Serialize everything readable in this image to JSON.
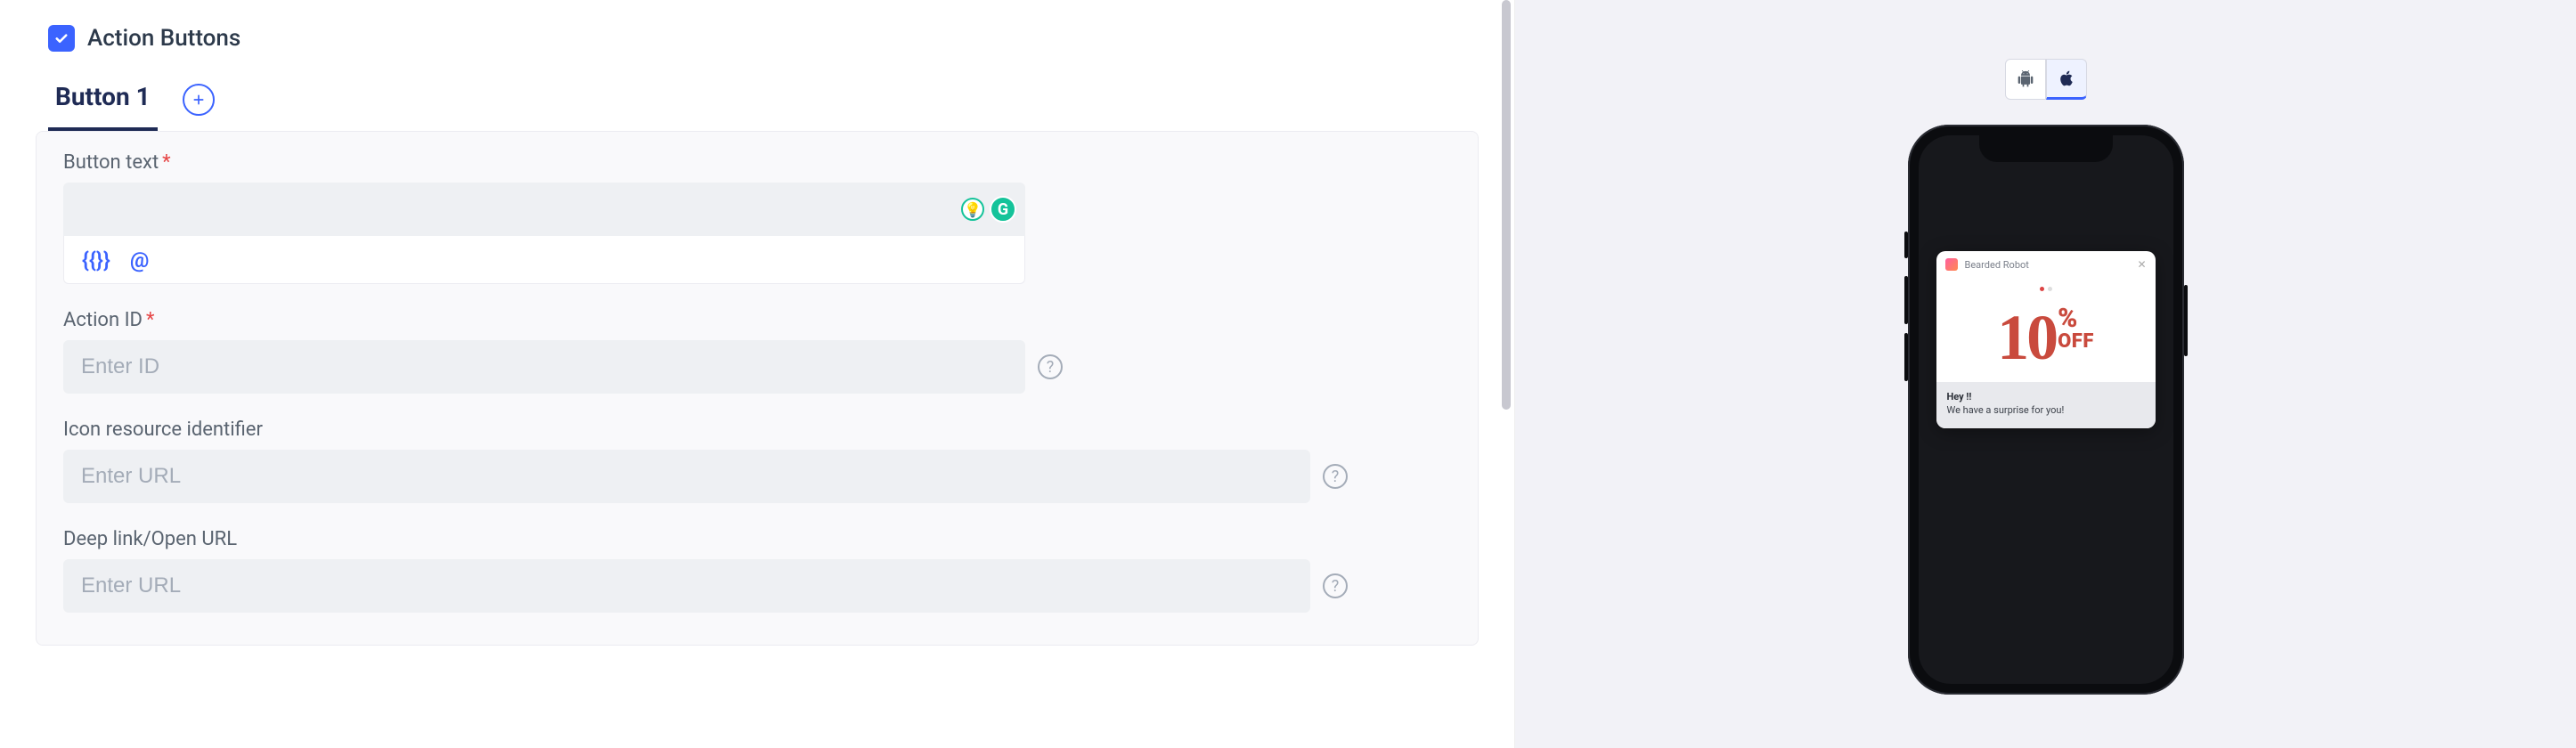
{
  "section": {
    "title": "Action Buttons",
    "checked": true
  },
  "tabs": {
    "active": "Button 1"
  },
  "fields": {
    "button_text": {
      "label": "Button text",
      "value": "",
      "toolbar": {
        "braces": "{{}}",
        "at": "@"
      }
    },
    "action_id": {
      "label": "Action ID",
      "placeholder": "Enter ID",
      "value": ""
    },
    "icon_resource": {
      "label": "Icon resource identifier",
      "placeholder": "Enter URL",
      "value": ""
    },
    "deep_link": {
      "label": "Deep link/Open URL",
      "placeholder": "Enter URL",
      "value": ""
    }
  },
  "preview": {
    "app_name": "Bearded Robot",
    "promo_number": "10",
    "promo_pct": "%",
    "promo_off": "OFF",
    "title": "Hey !!",
    "body": "We have a surprise for you!"
  }
}
